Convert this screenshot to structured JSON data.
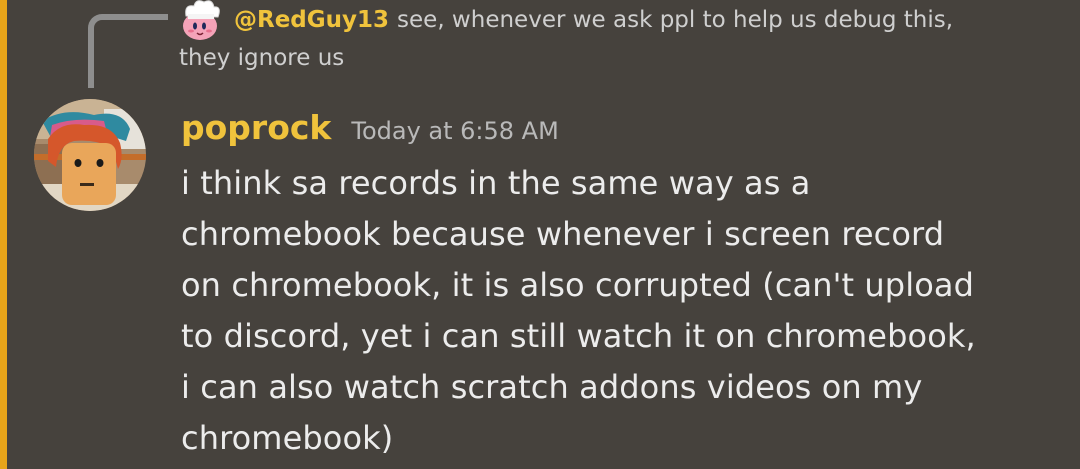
{
  "reply": {
    "author": "@RedGuy13",
    "text_line1": "see, whenever we ask ppl to help us debug this,",
    "text_line2": "they ignore us",
    "avatar_icon": "kirby-chef-avatar-icon"
  },
  "message": {
    "author": "poprock",
    "timestamp": "Today at 6:58 AM",
    "avatar_icon": "roblox-character-avatar",
    "content_lines": [
      "i think sa records in the same way as a",
      "chromebook because whenever i screen record",
      "on chromebook, it is also corrupted (can't upload",
      "to discord, yet i can still watch it on chromebook,",
      "i can also watch scratch addons videos on my",
      "chromebook)"
    ]
  },
  "colors": {
    "background": "#46423d",
    "mention_highlight": "#e7a41a",
    "username": "#f0c33c",
    "text": "#ececec",
    "muted": "#b9b9b9"
  }
}
